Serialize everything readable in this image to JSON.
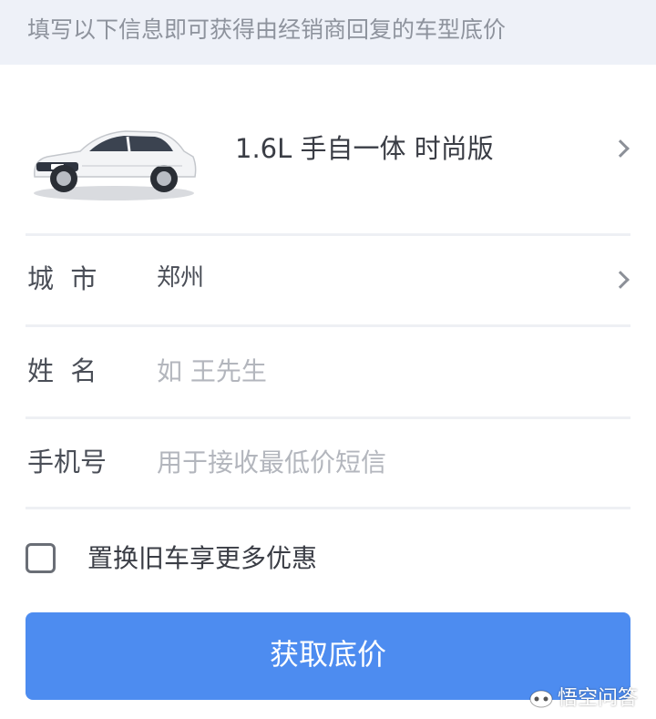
{
  "banner": {
    "text": "填写以下信息即可获得由经销商回复的车型底价"
  },
  "car": {
    "model": "1.6L 手自一体 时尚版",
    "image_icon": "car-image"
  },
  "form": {
    "city": {
      "label": "城  市",
      "value": "郑州"
    },
    "name": {
      "label": "姓  名",
      "placeholder": "如 王先生"
    },
    "phone": {
      "label": "手机号",
      "placeholder": "用于接收最低价短信"
    }
  },
  "trade_in": {
    "label": "置换旧车享更多优惠",
    "checked": false
  },
  "submit": {
    "label": "获取底价"
  },
  "watermark": {
    "text": "悟空问答"
  },
  "colors": {
    "button": "#4d8cf0",
    "banner_bg": "#eef1f8"
  }
}
